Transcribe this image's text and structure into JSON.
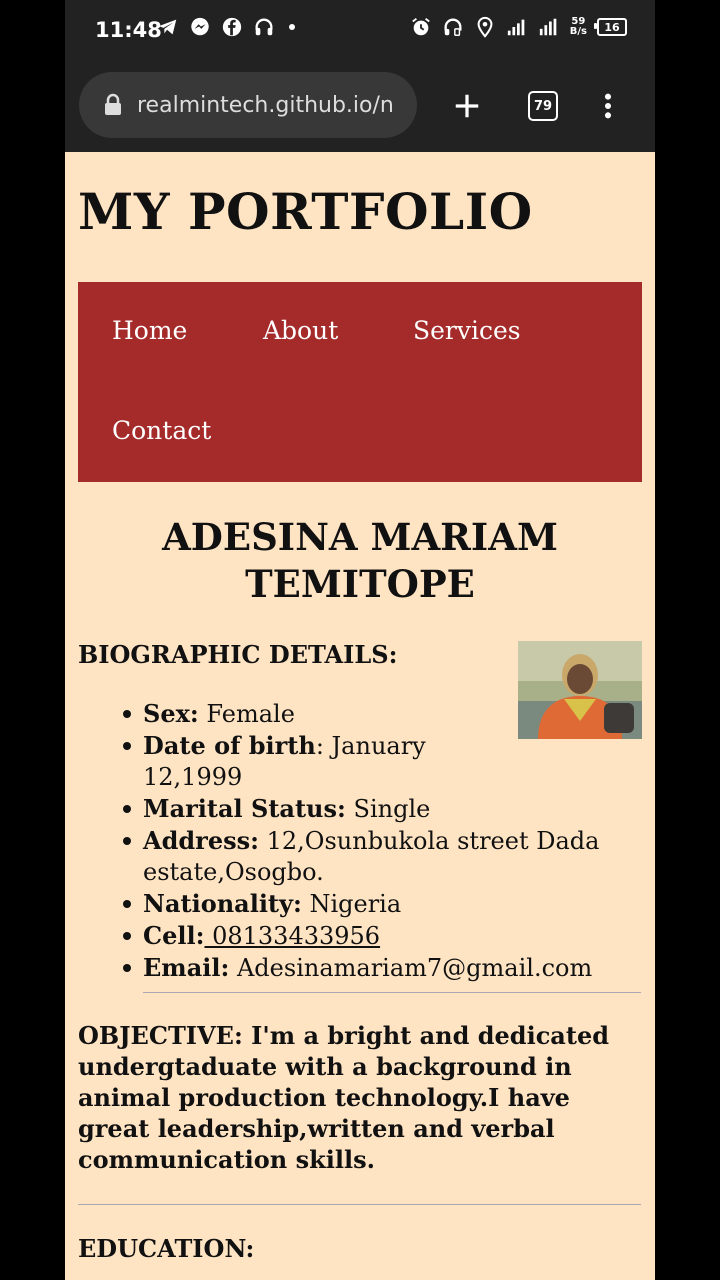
{
  "status_bar": {
    "time": "11:48",
    "network_speed_value": "59",
    "network_speed_unit": "B/s",
    "battery": "16"
  },
  "browser": {
    "url": "realmintech.github.io/n",
    "tab_count": "79"
  },
  "page": {
    "site_title": "MY PORTFOLIO",
    "nav": [
      {
        "label": "Home"
      },
      {
        "label": "About"
      },
      {
        "label": "Services"
      },
      {
        "label": "Contact"
      }
    ],
    "name_line1": "ADESINA MARIAM",
    "name_line2": "TEMITOPE",
    "bio_heading": "BIOGRAPHIC DETAILS:",
    "details": [
      {
        "key": "Sex:",
        "value": " Female"
      },
      {
        "key": "Date of birth",
        "value": ": January 12,1999"
      },
      {
        "key": "Marital Status:",
        "value": " Single"
      },
      {
        "key": "Address:",
        "value": " 12,Osunbukola street Dada estate,Osogbo."
      },
      {
        "key": "Nationality:",
        "value": " Nigeria"
      },
      {
        "key": "Cell:",
        "value": " 08133433956"
      },
      {
        "key": "Email:",
        "value": " Adesinamariam7@gmail.com"
      }
    ],
    "objective": "OBJECTIVE: I'm a bright and dedicated undergtaduate with a background in animal production technology.I have great leadership,written and verbal communication skills.",
    "education_heading": "EDUCATION:"
  }
}
